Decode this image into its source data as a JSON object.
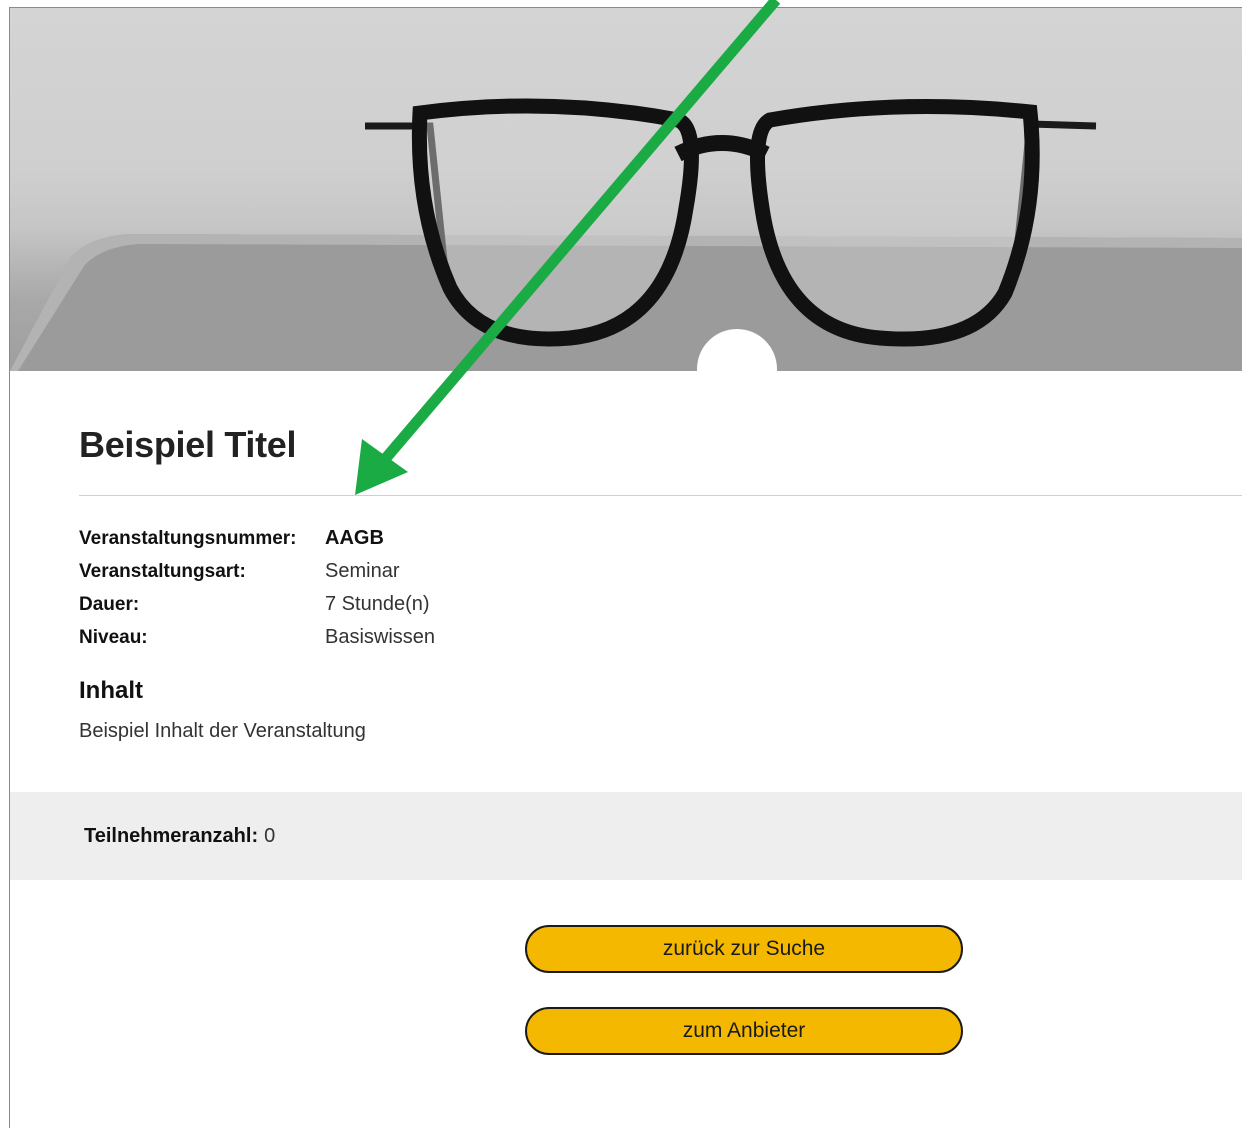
{
  "event": {
    "title": "Beispiel Titel",
    "details": [
      {
        "label": "Veranstaltungsnummer:",
        "value": "AAGB"
      },
      {
        "label": "Veranstaltungsart:",
        "value": "Seminar"
      },
      {
        "label": "Dauer:",
        "value": "7 Stunde(n)"
      },
      {
        "label": "Niveau:",
        "value": "Basiswissen"
      }
    ],
    "content_heading": "Inhalt",
    "content_text": "Beispiel Inhalt der Veranstaltung"
  },
  "participants": {
    "label": "Teilnehmeranzahl:",
    "value": "0"
  },
  "buttons": {
    "back_label": "zurück zur Suche",
    "provider_label": "zum Anbieter"
  },
  "colors": {
    "button": "#f5b800",
    "annotation_arrow": "#1aab45",
    "band": "#eeeeee"
  },
  "icons": {
    "hero": "eyeglasses-photo",
    "annotation": "green-arrow"
  }
}
